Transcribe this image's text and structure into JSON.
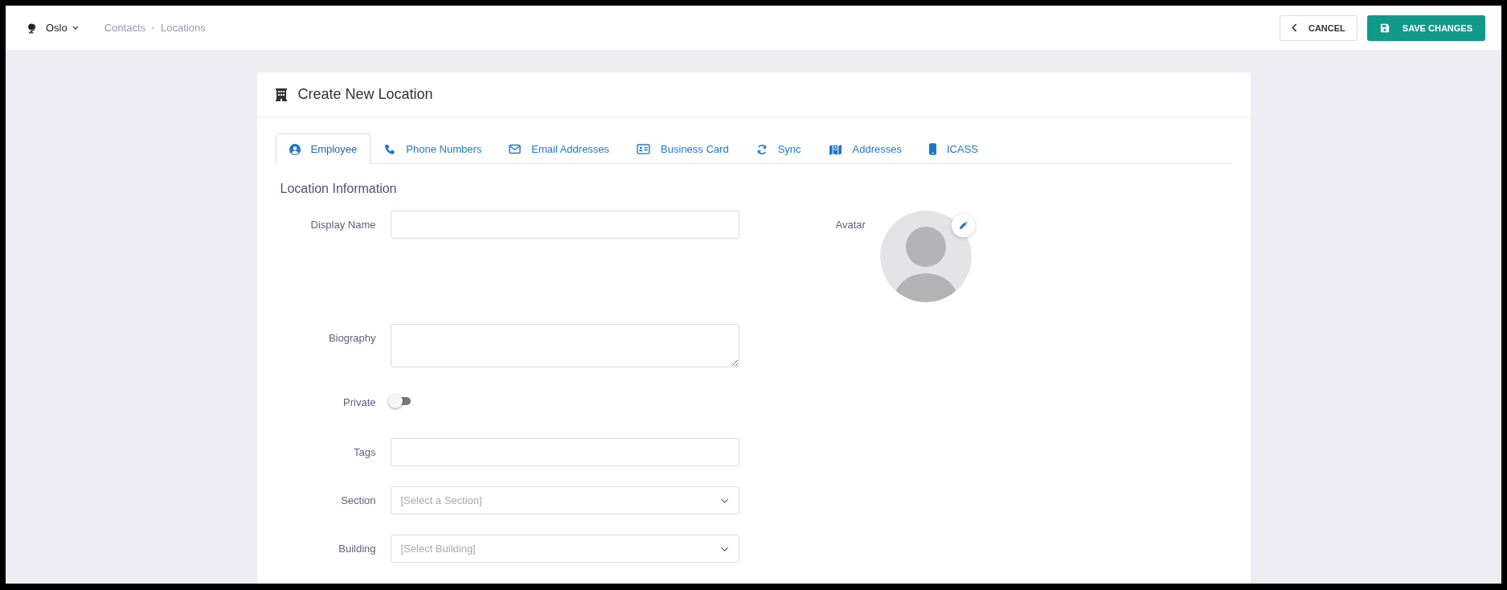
{
  "topbar": {
    "site": "Oslo",
    "breadcrumbs": [
      "Contacts",
      "Locations"
    ],
    "cancel": "CANCEL",
    "save": "SAVE CHANGES"
  },
  "card": {
    "title": "Create New Location",
    "tabs": [
      {
        "label": "Employee",
        "selected": true
      },
      {
        "label": "Phone Numbers",
        "selected": false
      },
      {
        "label": "Email Addresses",
        "selected": false
      },
      {
        "label": "Business Card",
        "selected": false
      },
      {
        "label": "Sync",
        "selected": false
      },
      {
        "label": "Addresses",
        "selected": false
      },
      {
        "label": "ICASS",
        "selected": false
      }
    ],
    "section_title": "Location Information",
    "fields": [
      {
        "kind": "text",
        "label": "Display Name"
      },
      {
        "kind": "textarea",
        "label": "Biography"
      },
      {
        "kind": "toggle",
        "label": "Private",
        "on": false
      },
      {
        "kind": "text",
        "label": "Tags"
      },
      {
        "kind": "select",
        "label": "Section",
        "placeholder": "[Select a Section]"
      },
      {
        "kind": "select",
        "label": "Building",
        "placeholder": "[Select Building]"
      }
    ],
    "avatar": {
      "label": "Avatar"
    }
  }
}
